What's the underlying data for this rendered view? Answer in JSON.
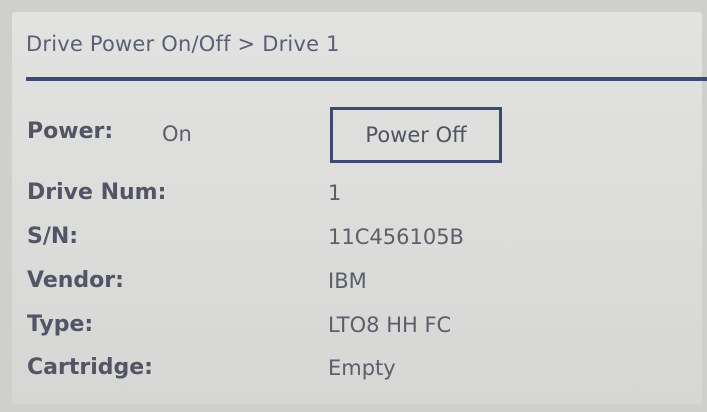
{
  "header": {
    "breadcrumb": "Drive Power On/Off > Drive 1"
  },
  "power": {
    "label": "Power:",
    "value": "On",
    "button_label": "Power Off"
  },
  "details": [
    {
      "label": "Drive Num:",
      "value": "1"
    },
    {
      "label": "S/N:",
      "value": "11C456105B"
    },
    {
      "label": "Vendor:",
      "value": "IBM"
    },
    {
      "label": "Type:",
      "value": "LTO8 HH FC"
    },
    {
      "label": "Cartridge:",
      "value": "Empty"
    }
  ],
  "colors": {
    "accent": "#3d4a6f",
    "text": "#525566",
    "background": "#dcdcda"
  }
}
